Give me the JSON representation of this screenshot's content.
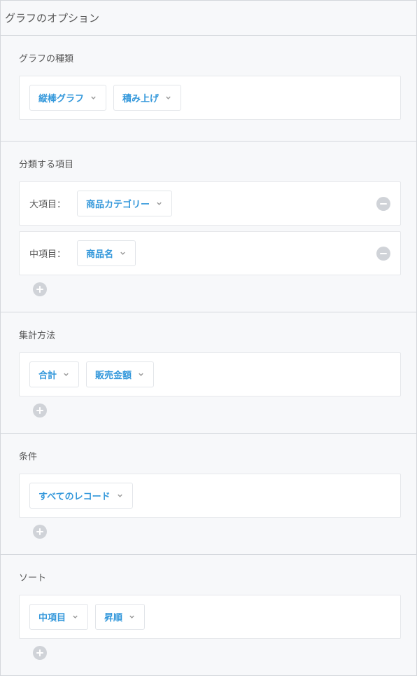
{
  "panel": {
    "title": "グラフのオプション"
  },
  "chartType": {
    "label": "グラフの種類",
    "typeSelect": "縦棒グラフ",
    "stackSelect": "積み上げ"
  },
  "groupBy": {
    "label": "分類する項目",
    "rows": [
      {
        "prefix": "大項目：",
        "value": "商品カテゴリー"
      },
      {
        "prefix": "中項目：",
        "value": "商品名"
      }
    ]
  },
  "aggregate": {
    "label": "集計方法",
    "method": "合計",
    "field": "販売金額"
  },
  "condition": {
    "label": "条件",
    "value": "すべてのレコード"
  },
  "sort": {
    "label": "ソート",
    "field": "中項目",
    "order": "昇順"
  }
}
